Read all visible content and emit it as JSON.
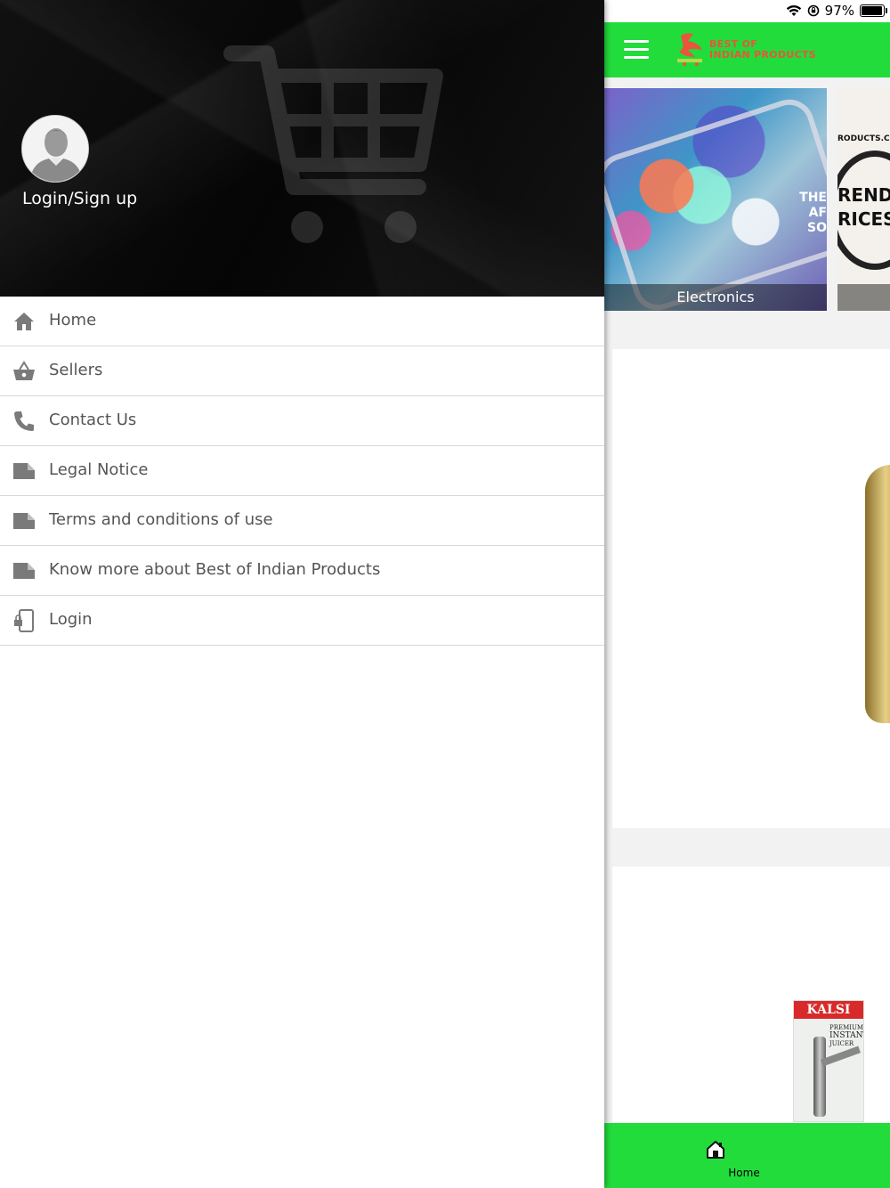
{
  "status_bar": {
    "battery": "97%",
    "icons": [
      "wifi-icon",
      "orientation-lock-icon",
      "battery-icon"
    ],
    "battery_level": 0.97
  },
  "app": {
    "logo": {
      "line1": "BEST OF",
      "line2": "INDIAN PRODUCTS"
    },
    "categories": [
      {
        "label": "Electronics"
      },
      {
        "label": ""
      }
    ],
    "trend_banner": {
      "line1": "RODUCTS.CO",
      "line2": "REND",
      "line3": "RICES",
      "overlay_line1": "THE AF",
      "overlay_line2": "SO"
    },
    "product_brand": {
      "name": "KALSI",
      "line1": "PREMIUM",
      "line2": "INSTANT",
      "line3": "JUICER"
    },
    "bottom_tab": {
      "label": "Home"
    }
  },
  "drawer": {
    "login_label": "Login/Sign up",
    "menu": [
      {
        "label": "Home",
        "icon": "home-icon"
      },
      {
        "label": "Sellers",
        "icon": "basket-icon"
      },
      {
        "label": "Contact Us",
        "icon": "phone-icon"
      },
      {
        "label": "Legal Notice",
        "icon": "document-icon"
      },
      {
        "label": "Terms and conditions of use",
        "icon": "document-icon"
      },
      {
        "label": "Know more about Best of Indian Products",
        "icon": "document-icon"
      },
      {
        "label": "Login",
        "icon": "login-lock-icon"
      }
    ]
  },
  "colors": {
    "accent_green": "#22dc3c",
    "drawer_header": "#0a0a0a",
    "menu_text": "#555555",
    "menu_icon": "#7a7a7a"
  }
}
